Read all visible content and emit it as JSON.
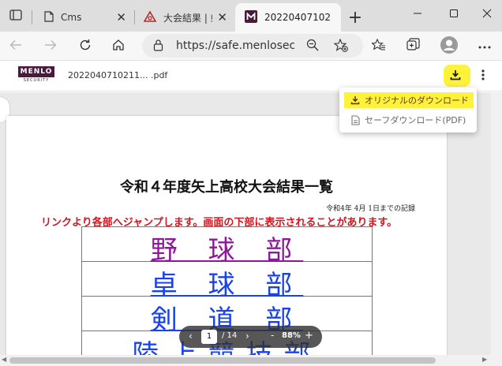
{
  "tabs": [
    {
      "title": "Cms",
      "icon": "page-icon"
    },
    {
      "title": "大会結果 | 県",
      "icon": "school-crest-icon"
    },
    {
      "title": "20220407102",
      "icon": "menlo-m-icon"
    }
  ],
  "address_bar": {
    "url": "https://safe.menlosec..."
  },
  "viewer": {
    "logo_text": "MENLO",
    "logo_subtext": "SECURITY",
    "filename": "2022040710211... .pdf"
  },
  "download_menu": {
    "original_label": "オリジナルのダウンロード",
    "safe_label": "セーフダウンロード(PDF)"
  },
  "document": {
    "title": "令和４年度矢上高校大会結果一覧",
    "date_note": "令和4年 4月 1日までの記録",
    "notice": "リンクより各部へジャンプします。画面の下部に表示されることがあります。",
    "clubs": [
      {
        "name": "野 球 部",
        "color": "#8d189b"
      },
      {
        "name": "卓 球 部",
        "color": "#1742ee"
      },
      {
        "name": "剣 道 部",
        "color": "#1742ee"
      },
      {
        "name": "陸上競技部",
        "color": "#1742ee"
      }
    ]
  },
  "pager": {
    "prev": "‹",
    "next": "›",
    "current_page": "1",
    "total": "/ 14",
    "zoom_out": "-",
    "zoom": "88%",
    "zoom_in": "+"
  },
  "colors": {
    "highlight": "#fff23b",
    "menlo_brand": "#4a1a3c",
    "notice_red": "#d4141e"
  }
}
